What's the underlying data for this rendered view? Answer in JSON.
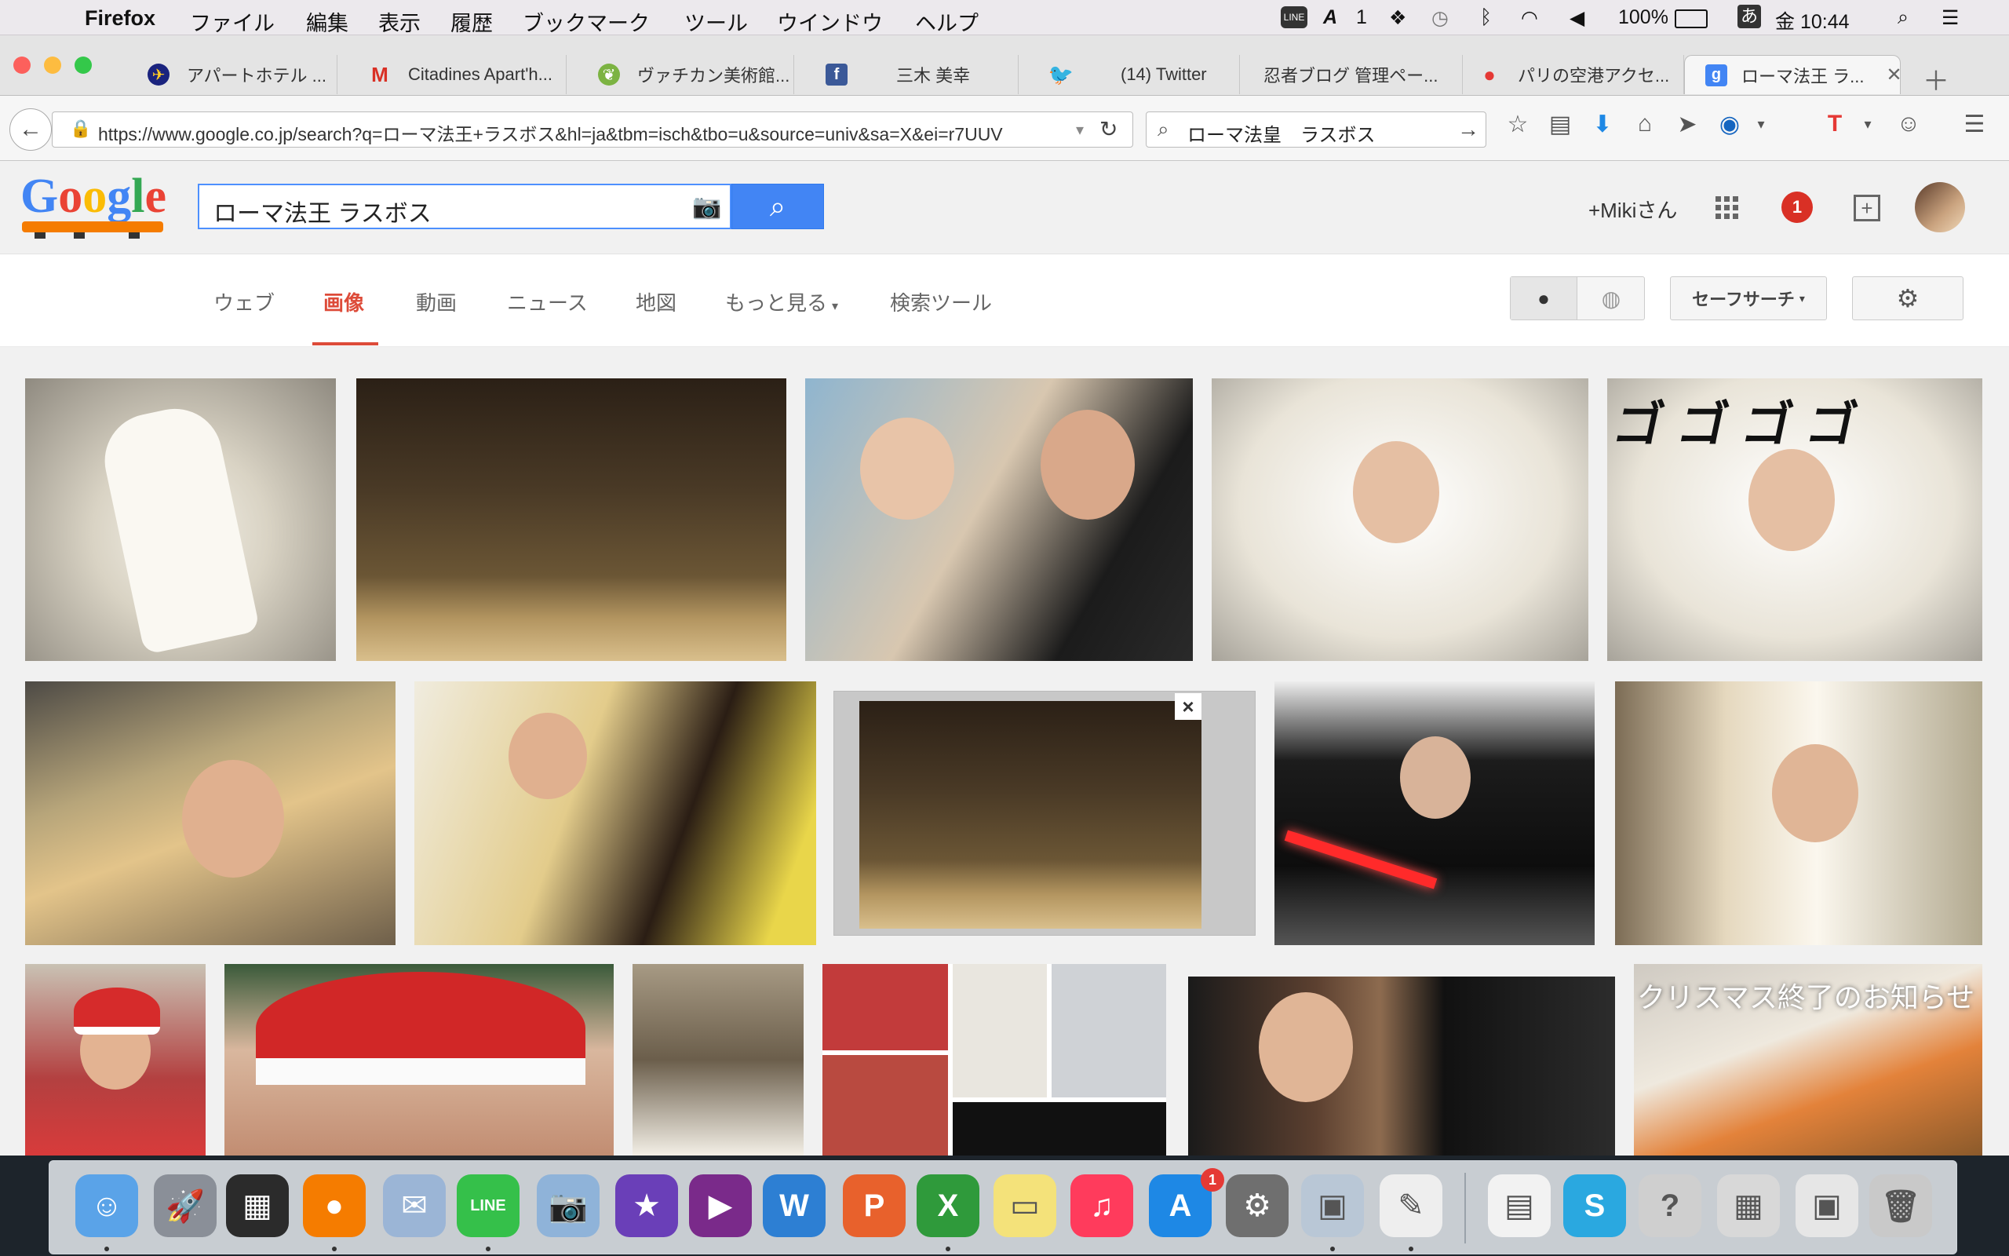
{
  "menubar": {
    "app": "Firefox",
    "items": [
      "ファイル",
      "編集",
      "表示",
      "履歴",
      "ブックマーク",
      "ツール",
      "ウインドウ",
      "ヘルプ"
    ],
    "status": {
      "badge": "1",
      "battery": "100%",
      "input": "あ",
      "clock": "金 10:44"
    }
  },
  "tabs": [
    {
      "label": "アパートホテル ...",
      "icon": "globe-icon",
      "color": "#f0b400"
    },
    {
      "label": "Citadines Apart'h...",
      "icon": "gmail-icon",
      "color": "#d93025"
    },
    {
      "label": "ヴァチカン美術館...",
      "icon": "leaf-icon",
      "color": "#7cb342"
    },
    {
      "label": "三木 美幸",
      "icon": "facebook-icon",
      "color": "#3b5998"
    },
    {
      "label": "(14) Twitter",
      "icon": "twitter-icon",
      "color": "#55acee"
    },
    {
      "label": "忍者ブログ 管理ペー...",
      "icon": "",
      "color": ""
    },
    {
      "label": "パリの空港アクセ...",
      "icon": "apple-icon",
      "color": "#e53935"
    },
    {
      "label": "ローマ法王 ラ...",
      "icon": "google-icon",
      "color": "#4285f4"
    }
  ],
  "toolbar": {
    "url": "https://www.google.co.jp/search?q=ローマ法王+ラスボス&hl=ja&tbm=isch&tbo=u&source=univ&sa=X&ei=r7UUV",
    "search_value": "ローマ法皇　ラスボス"
  },
  "google": {
    "query": "ローマ法王 ラスボス",
    "user": "+Mikiさん",
    "notifications": "1",
    "nav": [
      "ウェブ",
      "画像",
      "動画",
      "ニュース",
      "地図",
      "もっと見る",
      "検索ツール"
    ],
    "active_nav": "画像",
    "safesearch": "セーフサーチ",
    "accent": "#dd4b39"
  },
  "results": {
    "overlay_text_1": "ゴゴゴゴ",
    "overlay_text_2": "クリスマス終了のお知らせ",
    "close_icon": "×"
  },
  "dock": {
    "apps": [
      "Finder",
      "Launchpad",
      "Dashboard",
      "Firefox",
      "Mail",
      "LINE",
      "iPhoto",
      "iMovie",
      "Adobe",
      "Word",
      "PowerPoint",
      "Excel",
      "Notes",
      "iTunes",
      "App Store",
      "System Preferences",
      "Preview",
      "TextEdit",
      "Documents",
      "Skype",
      "Help",
      "Spreadsheet",
      "Screenshot",
      "Trash"
    ],
    "appstore_badge": "1"
  }
}
